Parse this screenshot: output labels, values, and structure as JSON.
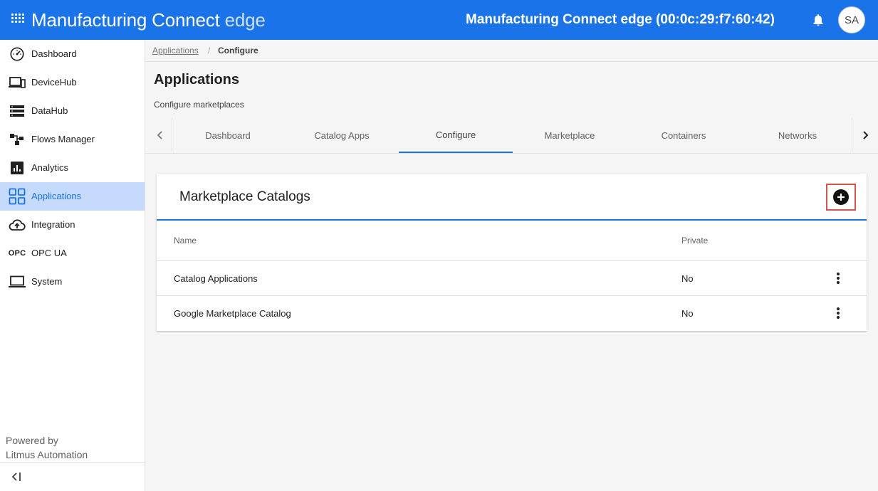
{
  "header": {
    "brand_main": "Manufacturing Connect",
    "brand_light": "edge",
    "device_title": "Manufacturing Connect edge (00:0c:29:f7:60:42)",
    "avatar_initials": "SA",
    "accent_color": "#1a73e8"
  },
  "sidebar": {
    "items": [
      {
        "label": "Dashboard",
        "icon": "speedometer-icon"
      },
      {
        "label": "DeviceHub",
        "icon": "devices-icon"
      },
      {
        "label": "DataHub",
        "icon": "storage-icon"
      },
      {
        "label": "Flows Manager",
        "icon": "flow-icon"
      },
      {
        "label": "Analytics",
        "icon": "analytics-icon"
      },
      {
        "label": "Applications",
        "icon": "apps-grid-icon",
        "active": true
      },
      {
        "label": "Integration",
        "icon": "cloud-upload-icon"
      },
      {
        "label": "OPC UA",
        "icon": "opc-icon",
        "icon_text": "OPC"
      },
      {
        "label": "System",
        "icon": "laptop-icon"
      }
    ],
    "powered_line1": "Powered by",
    "powered_line2": "Litmus Automation"
  },
  "breadcrumb": {
    "parent": "Applications",
    "separator": "/",
    "current": "Configure"
  },
  "page": {
    "title": "Applications",
    "subtitle": "Configure marketplaces"
  },
  "tabs": [
    {
      "label": "Dashboard"
    },
    {
      "label": "Catalog Apps"
    },
    {
      "label": "Configure",
      "active": true
    },
    {
      "label": "Marketplace"
    },
    {
      "label": "Containers"
    },
    {
      "label": "Networks"
    }
  ],
  "card": {
    "title": "Marketplace Catalogs",
    "columns": {
      "name": "Name",
      "private": "Private"
    },
    "rows": [
      {
        "name": "Catalog Applications",
        "private": "No"
      },
      {
        "name": "Google Marketplace Catalog",
        "private": "No"
      }
    ]
  }
}
